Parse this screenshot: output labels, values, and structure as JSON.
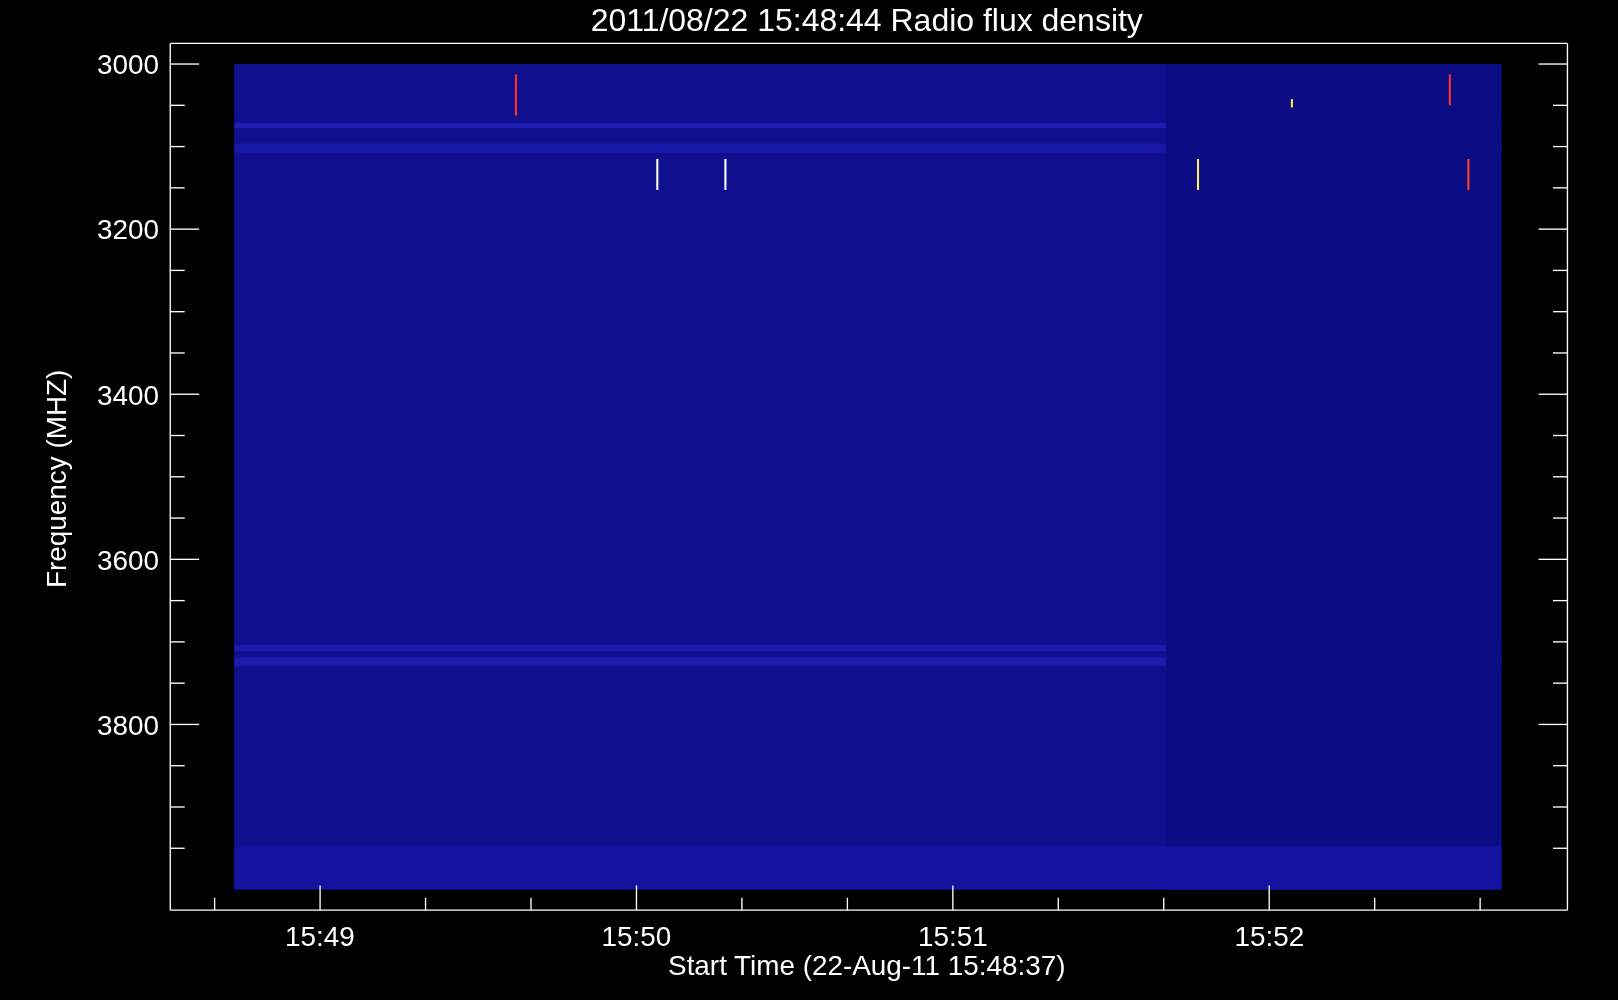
{
  "title": "2011/08/22 15:48:44 Radio flux density",
  "ylabel": "Frequency (MHZ)",
  "xlabel": "Start Time (22-Aug-11 15:48:37)",
  "yticks": [
    "3000",
    "3200",
    "3400",
    "3600",
    "3800"
  ],
  "xticks": [
    "15:49",
    "15:50",
    "15:51",
    "15:52"
  ]
}
